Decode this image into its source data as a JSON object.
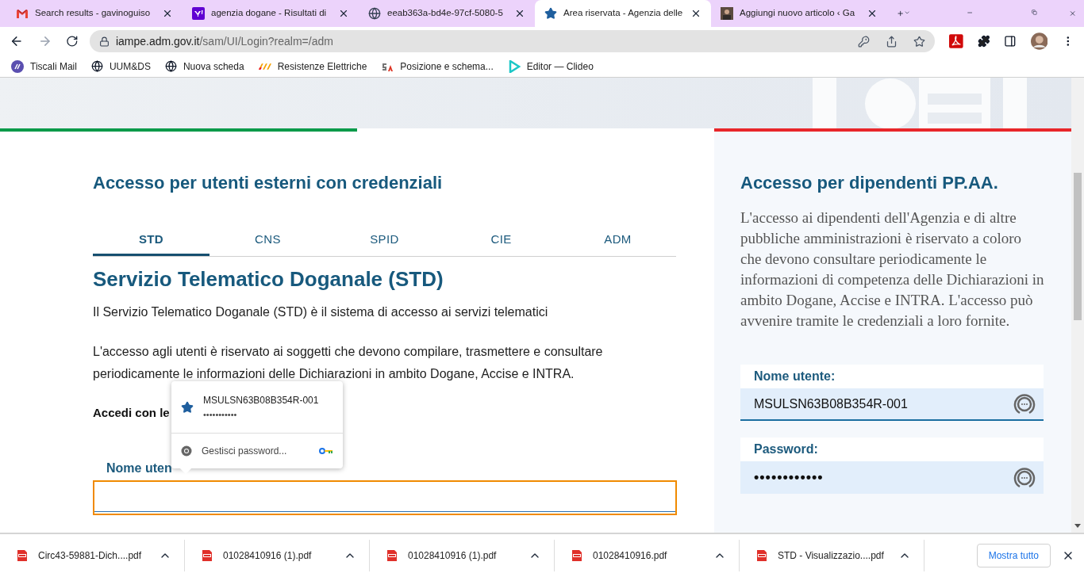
{
  "browser": {
    "tabs": [
      {
        "title": "Search results - gavinoguiso",
        "kind": "mail",
        "selected": false
      },
      {
        "title": "agenzia dogane - Risultati di",
        "kind": "yahoo",
        "selected": false
      },
      {
        "title": "eeab363a-bd4e-97cf-5080-5",
        "kind": "globe",
        "selected": false
      },
      {
        "title": "Area riservata - Agenzia delle",
        "kind": "star",
        "selected": true
      },
      {
        "title": "Aggiungi nuovo articolo ‹ Ga",
        "kind": "photo",
        "selected": false
      }
    ],
    "address": {
      "domain": "iampe.adm.gov.it",
      "path": "/sam/UI/Login?realm=/adm"
    },
    "bookmarks": [
      {
        "label": "Tiscali Mail",
        "kind": "slash"
      },
      {
        "label": "UUM&DS",
        "kind": "globe"
      },
      {
        "label": "Nuova scheda",
        "kind": "globe"
      },
      {
        "label": "Resistenze Elettriche",
        "kind": "bars"
      },
      {
        "label": "Posizione e schema...",
        "kind": "sa"
      },
      {
        "label": "Editor — Clideo",
        "kind": "play"
      }
    ]
  },
  "left": {
    "heading": "Accesso per utenti esterni con credenziali",
    "tabs": [
      {
        "label": "STD",
        "selected": true
      },
      {
        "label": "CNS",
        "selected": false
      },
      {
        "label": "SPID",
        "selected": false
      },
      {
        "label": "CIE",
        "selected": false
      },
      {
        "label": "ADM",
        "selected": false
      }
    ],
    "title": "Servizio Telematico Doganale (STD)",
    "paragraphs": [
      "Il Servizio Telematico Doganale (STD) è il sistema di accesso ai servizi telematici",
      "L'accesso agli utenti è riservato ai soggetti che devono compilare, trasmettere e consultare periodicamente le informazioni delle Dichiarazioni in ambito Dogane, Accise e INTRA."
    ],
    "login_prompt": "Accedi con le",
    "username_label": "Nome uten"
  },
  "autofill": {
    "username": "MSULSN63B08B354R-001",
    "password": "•••••••••••",
    "manage": "Gestisci password..."
  },
  "right": {
    "heading": "Accesso per dipendenti PP.AA.",
    "text": "L'accesso ai dipendenti dell'Agenzia e di altre pubbliche amministrazioni è riservato a coloro che devono consultare periodicamente le informazioni di competenza delle Dichiarazioni in ambito Dogane, Accise e INTRA. L'accesso può avvenire tramite le credenziali a loro fornite.",
    "username_label": "Nome utente:",
    "username": "MSULSN63B08B354R-001",
    "password_label": "Password:",
    "password": "••••••••••••"
  },
  "downloads": {
    "files": [
      "Circ43-59881-Dich....pdf",
      "01028410916 (1).pdf",
      "01028410916 (1).pdf",
      "01028410916.pdf",
      "STD - Visualizzazio....pdf"
    ],
    "show_all": "Mostra tutto"
  }
}
